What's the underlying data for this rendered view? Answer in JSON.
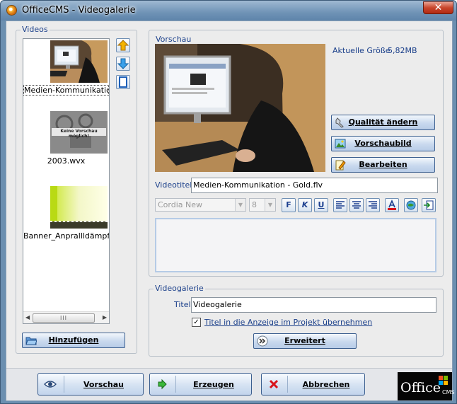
{
  "window": {
    "title": "OfficeCMS - Videogalerie",
    "close_label": "✕"
  },
  "videos_panel": {
    "label": "Videos",
    "items": [
      {
        "label": "Medien-Kommunikation -"
      },
      {
        "label": "2003.wvx",
        "placeholder_text": "Keine Vorschau möglich!"
      },
      {
        "label": "Banner_Anprallldämpfer_"
      }
    ],
    "scroll_grip": "III",
    "add_button": "Hinzufügen"
  },
  "preview": {
    "label": "Vorschau",
    "size_label": "Aktuelle Größe",
    "size_value": "5,82MB",
    "quality_button": "Qualität ändern",
    "preview_image_button": "Vorschaubild",
    "edit_button": "Bearbeiten",
    "video_title_label": "Videotitel",
    "video_title_value": "Medien-Kommunikation - Gold.flv",
    "font_family": "Cordia New",
    "font_size": "8",
    "bold": "F",
    "italic": "K",
    "underline": "U"
  },
  "gallery": {
    "label": "Videogalerie",
    "title_label": "Titel",
    "title_value": "Videogalerie",
    "checkbox_label": "Titel in die Anzeige im Projekt übernehmen",
    "checkbox_checked": true,
    "advanced_button": "Erweitert"
  },
  "footer": {
    "preview_button": "Vorschau",
    "create_button": "Erzeugen",
    "cancel_button": "Abbrechen",
    "logo_text": "Office",
    "logo_sub": "CMS"
  },
  "colors": {
    "accent": "#1a3f8a",
    "button_border": "#3c5f8f"
  }
}
